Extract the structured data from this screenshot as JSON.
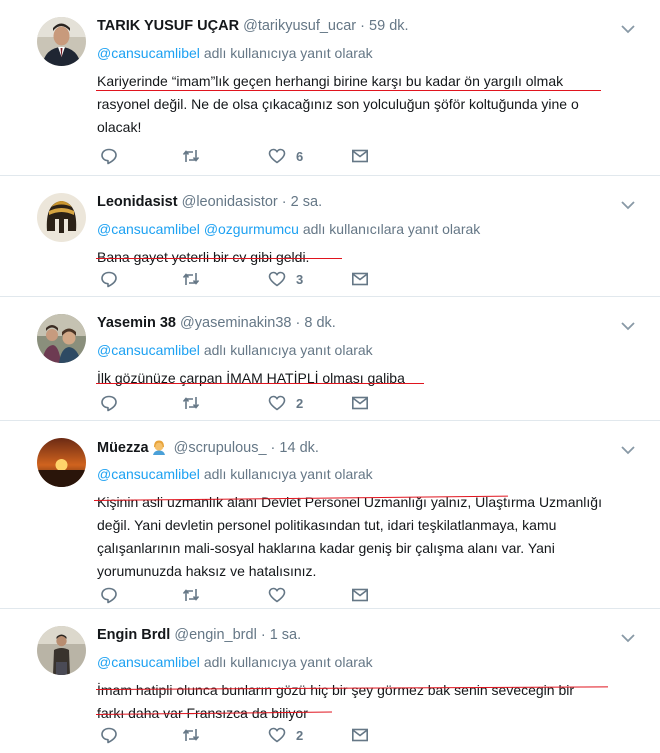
{
  "reply_label_single": "adlı kullanıcıya yanıt olarak",
  "reply_label_multi": "adlı kullanıcılara yanıt olarak",
  "dot": "·",
  "colors": {
    "link": "#1da1f2",
    "muted": "#657786",
    "underline": "#e0141e",
    "divider": "#e1e8ed"
  },
  "tweets": [
    {
      "name": "TARIK YUSUF UÇAR",
      "handle": "@tarikyusuf_ucar",
      "time": "59 dk.",
      "mentions": [
        "@cansucamlibel"
      ],
      "lines": [
        "Kariyerinde “imam”lık geçen herhangi birine karşı bu kadar ön yargılı olmak",
        "rasyonel değil. Ne de olsa çıkacağınız son yolculuğun şöför koltuğunda yine o",
        "olacak!"
      ],
      "likes": "6",
      "avatar_icon": "man-in-suit-avatar"
    },
    {
      "name": "Leonidasist",
      "handle": "@leonidasistor",
      "time": "2 sa.",
      "mentions": [
        "@cansucamlibel",
        "@ozgurmumcu"
      ],
      "lines": [
        "Bana gayet yeterli bir cv gibi geldi."
      ],
      "likes": "3",
      "avatar_icon": "spartan-helmet-avatar"
    },
    {
      "name": "Yasemin 38",
      "handle": "@yaseminakin38",
      "time": "8 dk.",
      "mentions": [
        "@cansucamlibel"
      ],
      "lines": [
        "İlk gözünüze çarpan İMAM HATİPLİ olması galiba"
      ],
      "likes": "2",
      "avatar_icon": "group-photo-avatar"
    },
    {
      "name": "Müezza",
      "handle": "@scrupulous_",
      "time": "14 dk.",
      "mentions": [
        "@cansucamlibel"
      ],
      "lines": [
        "Kişinin asli uzmanlık alanı Devlet Personel Uzmanlığı yalnız, Ulaştırma Uzmanlığı",
        "değil. Yani devletin personel politikasından tut, idari teşkilatlanmaya, kamu",
        "çalışanlarının mali-sosyal haklarına kadar geniş bir çalışma alanı var. Yani",
        "yorumunuzda haksız ve hatalısınız."
      ],
      "likes": "",
      "avatar_icon": "sunset-avatar",
      "name_emoji": "woman-emoji"
    },
    {
      "name": "Engin Brdl",
      "handle": "@engin_brdl",
      "time": "1 sa.",
      "mentions": [
        "@cansucamlibel"
      ],
      "lines": [
        "İmam hatipli olunca bunların gözü hiç bir şey görmez bak senin sevecegin bir",
        "farkı daha var Fransızca da biliyor"
      ],
      "likes": "2",
      "avatar_icon": "standing-man-avatar"
    }
  ]
}
